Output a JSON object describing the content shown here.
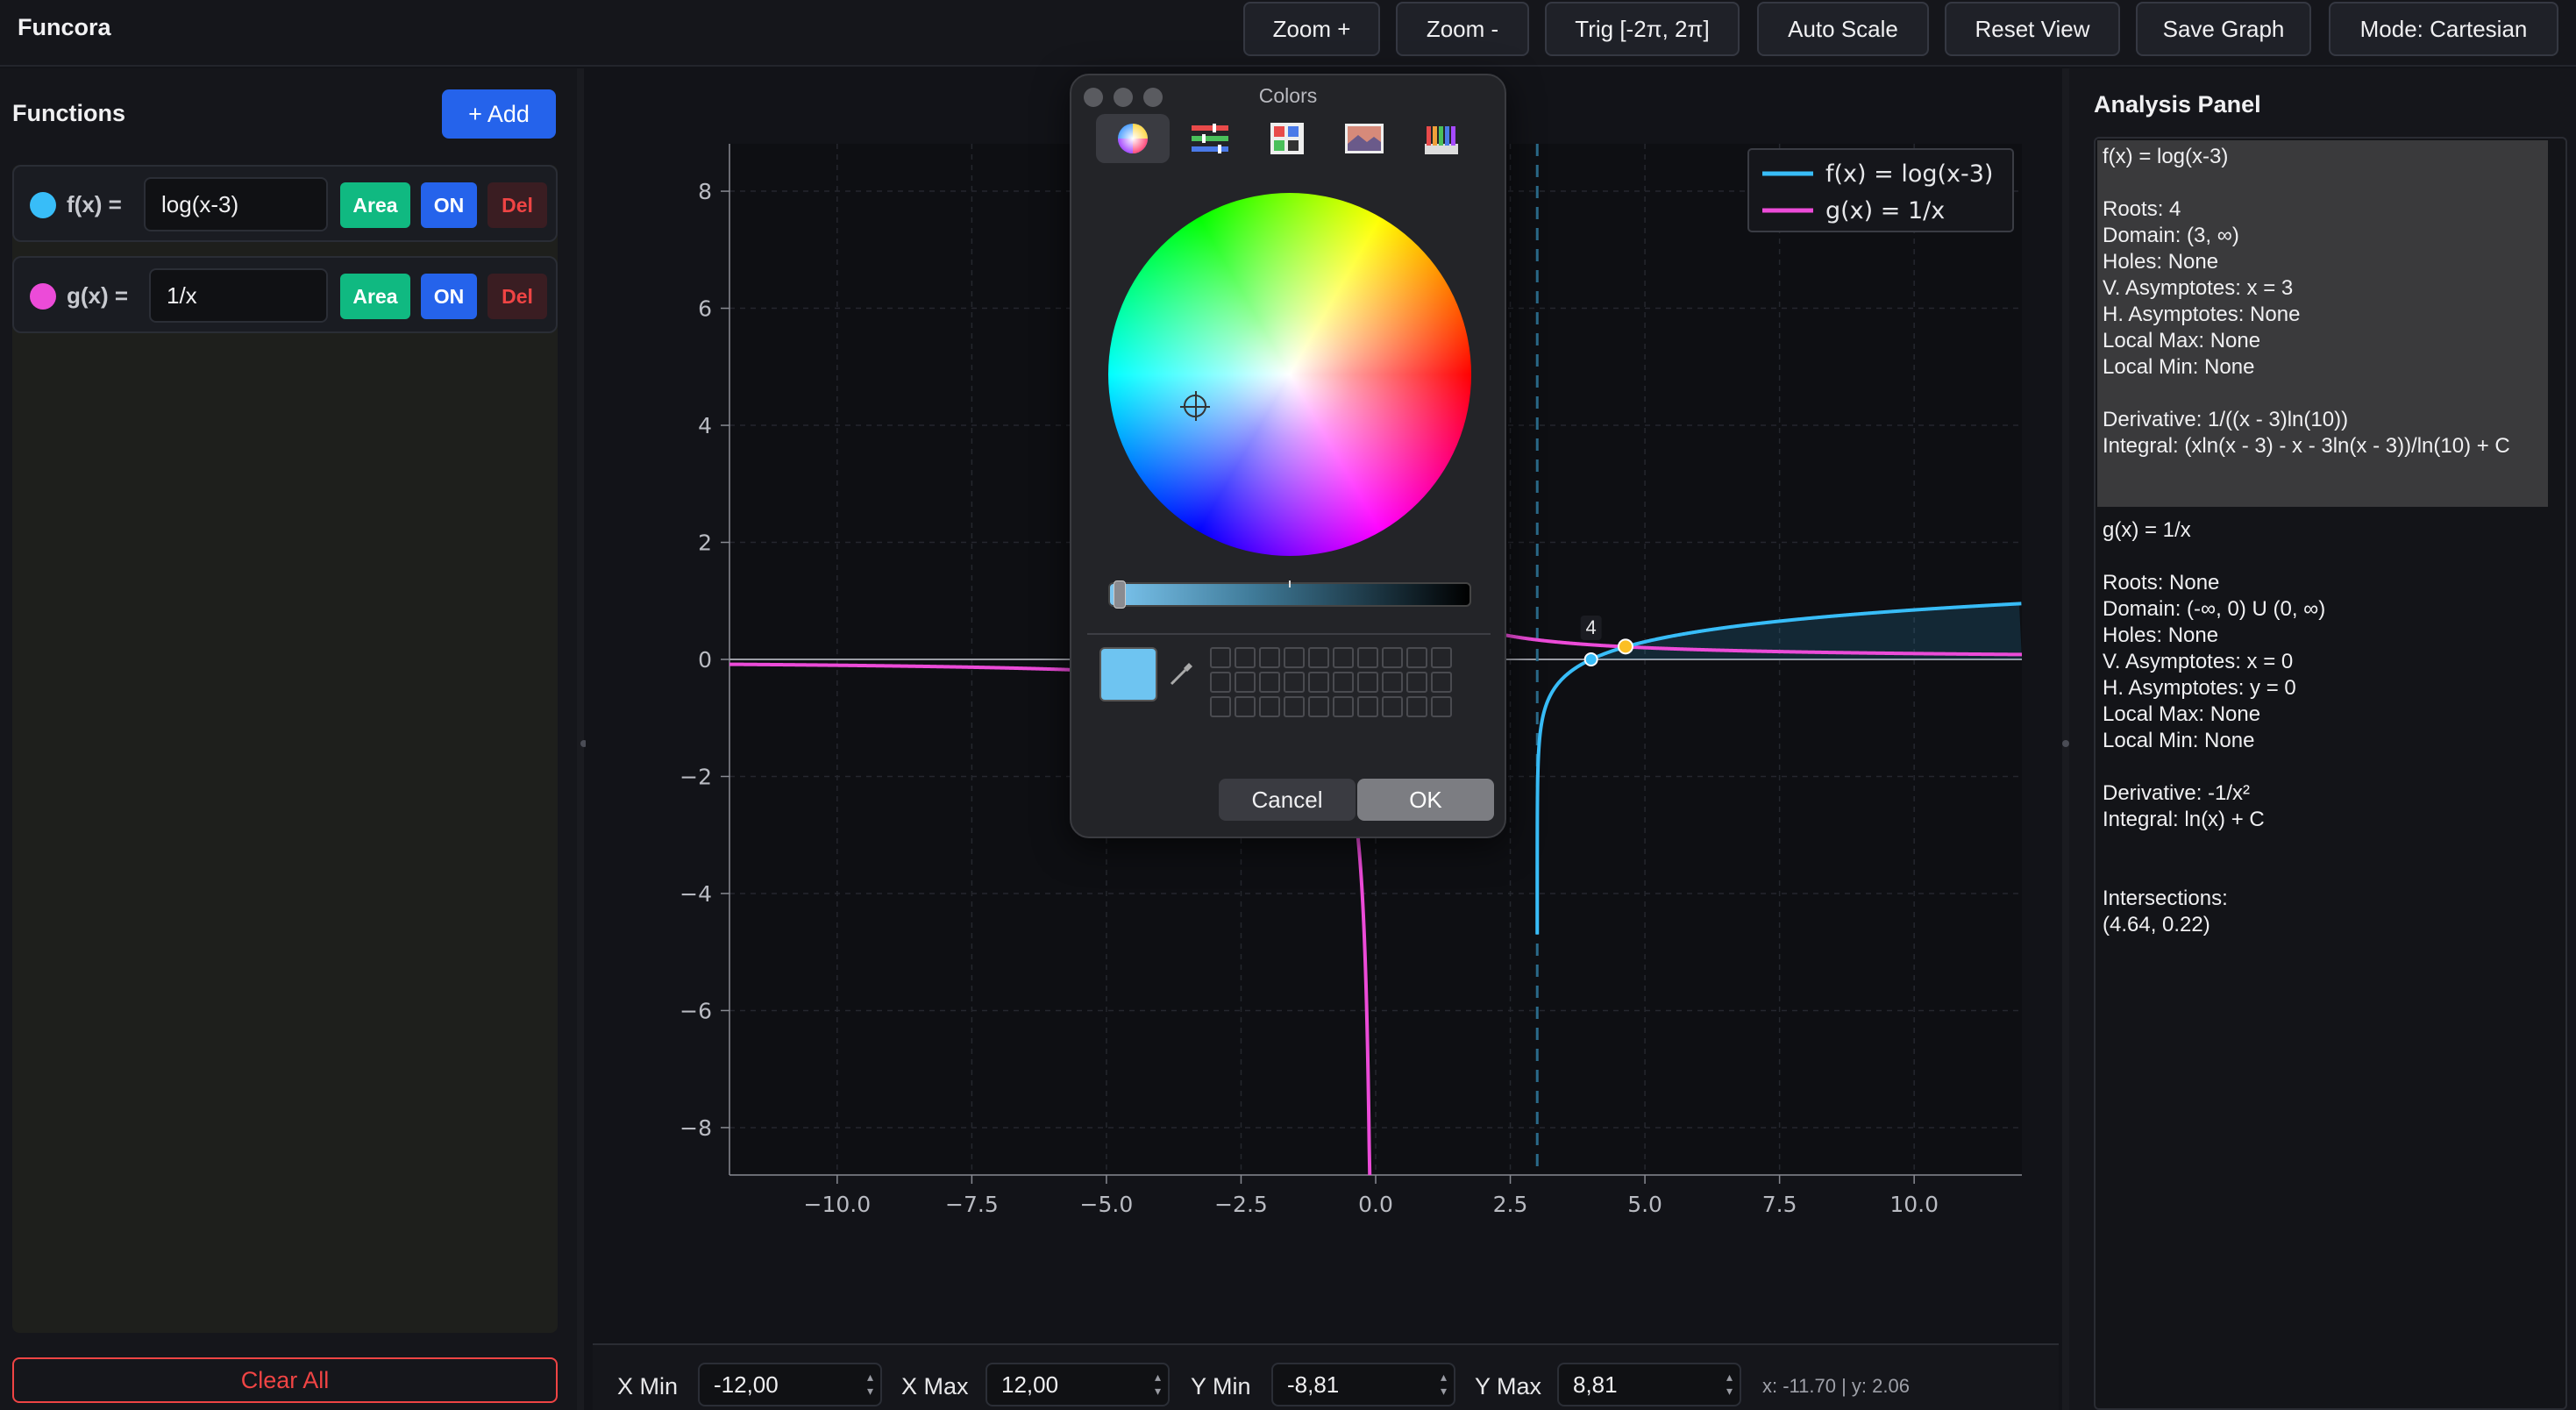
{
  "app": {
    "title": "Funcora"
  },
  "toolbar": {
    "zoom_in": "Zoom +",
    "zoom_out": "Zoom -",
    "trig": "Trig [-2π, 2π]",
    "auto_scale": "Auto Scale",
    "reset_view": "Reset View",
    "save_graph": "Save Graph",
    "mode": "Mode: Cartesian"
  },
  "functions_panel": {
    "heading": "Functions",
    "add_label": "+ Add",
    "clear_all": "Clear All",
    "items": [
      {
        "label": "f(x) =",
        "expr": "log(x-3)",
        "color": "#38bdf8",
        "area": "Area",
        "on": "ON",
        "del": "Del"
      },
      {
        "label": "g(x) =",
        "expr": "1/x",
        "color": "#ec4bd8",
        "area": "Area",
        "on": "ON",
        "del": "Del"
      }
    ]
  },
  "chart_data": {
    "type": "line",
    "xlim": [
      -12,
      12
    ],
    "ylim": [
      -8.81,
      8.81
    ],
    "grid": true,
    "legend_position": "top-right",
    "x_ticks": [
      "−10.0",
      "−7.5",
      "−5.0",
      "−2.5",
      "0.0",
      "2.5",
      "5.0",
      "7.5",
      "10.0"
    ],
    "x_tick_values": [
      -10,
      -7.5,
      -5,
      -2.5,
      0,
      2.5,
      5,
      7.5,
      10
    ],
    "y_ticks": [
      "8",
      "6",
      "4",
      "2",
      "0",
      "−2",
      "−4",
      "−6",
      "−8"
    ],
    "y_tick_values": [
      8,
      6,
      4,
      2,
      0,
      -2,
      -4,
      -6,
      -8
    ],
    "series": [
      {
        "name": "f(x) = log(x-3)",
        "color": "#38bdf8",
        "expr": "log10(x-3)"
      },
      {
        "name": "g(x) = 1/x",
        "color": "#ec4bd8",
        "expr": "1/x"
      }
    ],
    "vertical_asymptote": 3,
    "root_marker": {
      "x": 4,
      "y": 0,
      "label": "4"
    },
    "intersection_marker": {
      "x": 4.64,
      "y": 0.22,
      "color": "#fbbf24"
    }
  },
  "range": {
    "xmin_label": "X Min",
    "xmin": "-12,00",
    "xmax_label": "X Max",
    "xmax": "12,00",
    "ymin_label": "Y Min",
    "ymin": "-8,81",
    "ymax_label": "Y Max",
    "ymax": "8,81",
    "readout": "x: -11.70 | y: 2.06"
  },
  "analysis": {
    "title": "Analysis Panel",
    "f_block": [
      "f(x) = log(x-3)",
      "",
      "Roots: 4",
      "Domain: (3, ∞)",
      "Holes: None",
      "V. Asymptotes: x = 3",
      "H. Asymptotes: None",
      "Local Max: None",
      "Local Min: None",
      "",
      "Derivative: 1/((x - 3)ln(10))",
      "Integral: (xln(x - 3) - x - 3ln(x - 3))/ln(10) + C"
    ],
    "g_block": [
      "g(x) = 1/x",
      "",
      "Roots: None",
      "Domain: (-∞, 0) U (0, ∞)",
      "Holes: None",
      "V. Asymptotes: x = 0",
      "H. Asymptotes: y = 0",
      "Local Max: None",
      "Local Min: None",
      "",
      "Derivative: -1/x²",
      "Integral: ln(x) + C",
      "",
      "",
      "Intersections:",
      "(4.64, 0.22)"
    ]
  },
  "color_dialog": {
    "title": "Colors",
    "cancel": "Cancel",
    "ok": "OK",
    "current_color": "#6ec4f1"
  }
}
